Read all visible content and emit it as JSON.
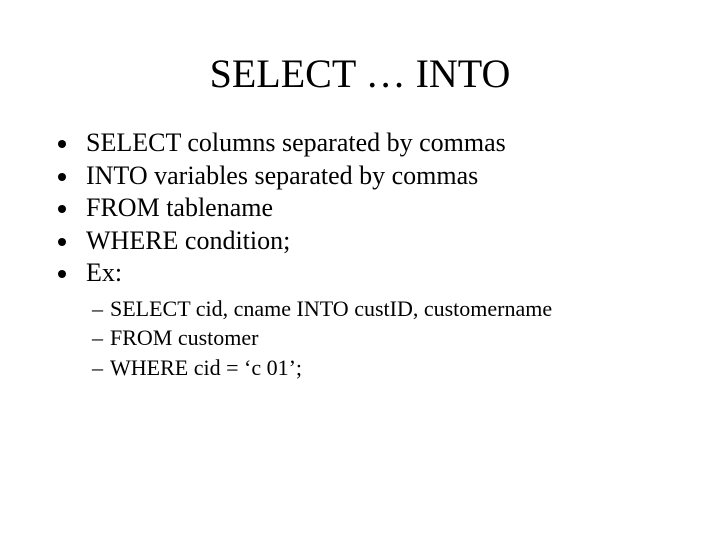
{
  "title": "SELECT … INTO",
  "bullets": [
    "SELECT columns separated by commas",
    "INTO variables separated by commas",
    "FROM tablename",
    "WHERE condition;",
    "Ex:"
  ],
  "subbullets": [
    "SELECT cid, cname INTO custID, customername",
    "FROM customer",
    "WHERE cid = ‘c 01’;"
  ]
}
